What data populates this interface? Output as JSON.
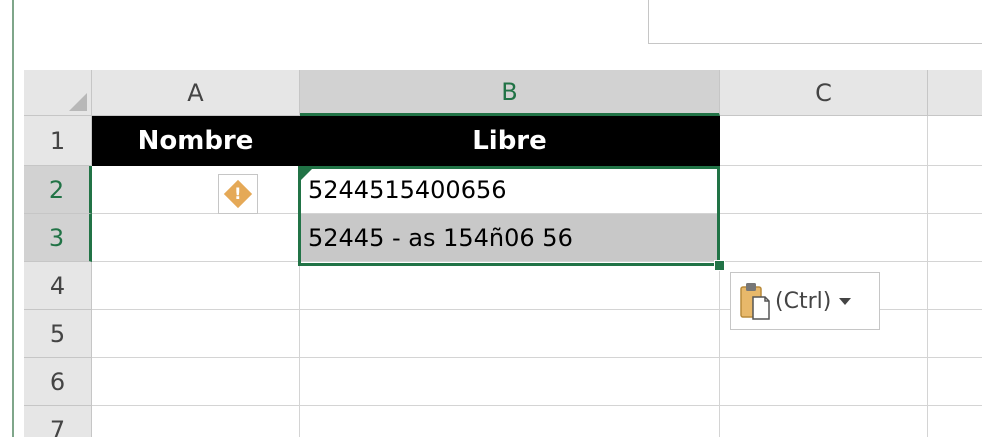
{
  "columns": [
    "A",
    "B",
    "C"
  ],
  "rows": [
    "1",
    "2",
    "3",
    "4",
    "5",
    "6",
    "7"
  ],
  "cells": {
    "A1": "Nombre",
    "B1": "Libre",
    "B2": "5244515400656",
    "B3": "52445 - as 154ñ06 56"
  },
  "paste_options": {
    "label": "(Ctrl)"
  },
  "colors": {
    "accent": "#217346",
    "header_bg": "#000000",
    "selection_bg": "#c8c8c8",
    "warning": "#e5a957"
  }
}
